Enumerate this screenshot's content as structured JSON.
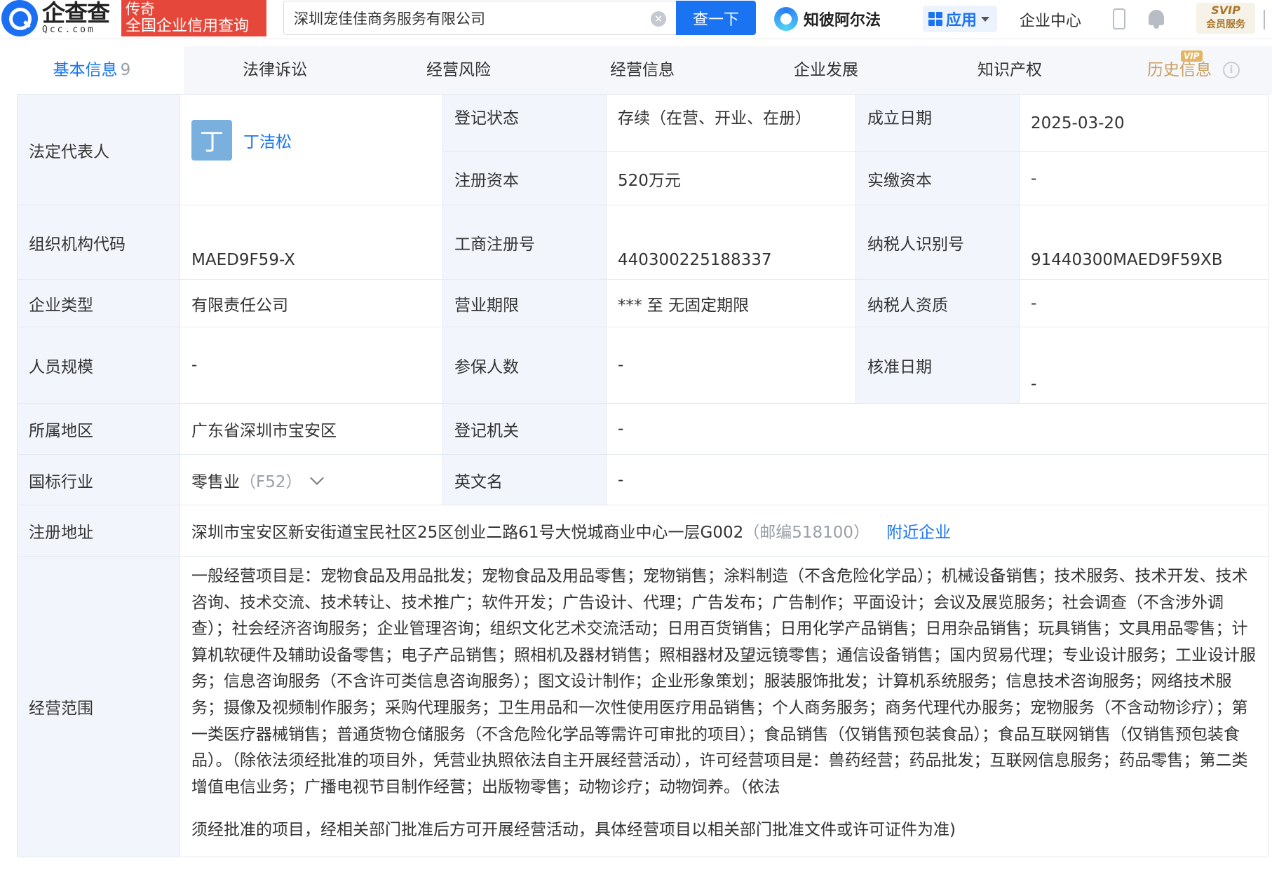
{
  "header": {
    "logo_cn": "企查查",
    "logo_en": "Qcc.com",
    "slogan_line1": "传奇",
    "slogan_line2": "全国企业信用查询",
    "search_value": "深圳宠佳佳商务服务有限公司",
    "search_button": "查一下",
    "zhibi_label": "知彼阿尔法",
    "app_label": "应用",
    "enterprise_center": "企业中心",
    "svip_top": "SVIP",
    "svip_bottom": "会员服务"
  },
  "tabs": [
    {
      "label": "基本信息",
      "count": "9"
    },
    {
      "label": "法律诉讼"
    },
    {
      "label": "经营风险"
    },
    {
      "label": "经营信息"
    },
    {
      "label": "企业发展"
    },
    {
      "label": "知识产权"
    },
    {
      "label": "历史信息",
      "badge": "VIP"
    }
  ],
  "company": {
    "legal_rep_label": "法定代表人",
    "legal_rep_avatar": "丁",
    "legal_rep_name": "丁洁松",
    "reg_status_label": "登记状态",
    "reg_status": "存续（在营、开业、在册）",
    "founded_label": "成立日期",
    "founded": "2025-03-20",
    "reg_capital_label": "注册资本",
    "reg_capital": "520万元",
    "paid_capital_label": "实缴资本",
    "paid_capital": "-",
    "org_code_label": "组织机构代码",
    "org_code": "MAED9F59-X",
    "biz_reg_no_label": "工商注册号",
    "biz_reg_no": "440300225188337",
    "taxpayer_id_label": "纳税人识别号",
    "taxpayer_id": "91440300MAED9F59XB",
    "company_type_label": "企业类型",
    "company_type": "有限责任公司",
    "biz_term_label": "营业期限",
    "biz_term": "*** 至 无固定期限",
    "taxpayer_qual_label": "纳税人资质",
    "taxpayer_qual": "-",
    "staff_size_label": "人员规模",
    "staff_size": "-",
    "insured_label": "参保人数",
    "insured": "-",
    "approval_date_label": "核准日期",
    "approval_date": "-",
    "region_label": "所属地区",
    "region": "广东省深圳市宝安区",
    "reg_authority_label": "登记机关",
    "reg_authority": "-",
    "industry_label": "国标行业",
    "industry": "零售业",
    "industry_code": "（F52）",
    "english_name_label": "英文名",
    "english_name": "-",
    "address_label": "注册地址",
    "address": "深圳市宝安区新安街道宝民社区25区创业二路61号大悦城商业中心一层G002",
    "postcode": "（邮编518100）",
    "nearby_link": "附近企业",
    "scope_label": "经营范围",
    "scope_text": "一般经营项目是：宠物食品及用品批发；宠物食品及用品零售；宠物销售；涂料制造（不含危险化学品）；机械设备销售；技术服务、技术开发、技术咨询、技术交流、技术转让、技术推广；软件开发；广告设计、代理；广告发布；广告制作；平面设计；会议及展览服务；社会调查（不含涉外调查）；社会经济咨询服务；企业管理咨询；组织文化艺术交流活动；日用百货销售；日用化学产品销售；日用杂品销售；玩具销售；文具用品零售；计算机软硬件及辅助设备零售；电子产品销售；照相机及器材销售；照相器材及望远镜零售；通信设备销售；国内贸易代理；专业设计服务；工业设计服务；信息咨询服务（不含许可类信息咨询服务）；图文设计制作；企业形象策划；服装服饰批发；计算机系统服务；信息技术咨询服务；网络技术服务；摄像及视频制作服务；采购代理服务；卫生用品和一次性使用医疗用品销售；个人商务服务；商务代理代办服务；宠物服务（不含动物诊疗）；第一类医疗器械销售；普通货物仓储服务（不含危险化学品等需许可审批的项目）；食品销售（仅销售预包装食品）；食品互联网销售（仅销售预包装食品）。（除依法须经批准的项目外，凭营业执照依法自主开展经营活动），许可经营项目是：兽药经营；药品批发；互联网信息服务；药品零售；第二类增值电信业务；广播电视节目制作经营；出版物零售；动物诊疗；动物饲养。（依法",
    "scope_text_tail": "须经批准的项目，经相关部门批准后方可开展经营活动，具体经营项目以相关部门批准文件或许可证件为准)"
  }
}
